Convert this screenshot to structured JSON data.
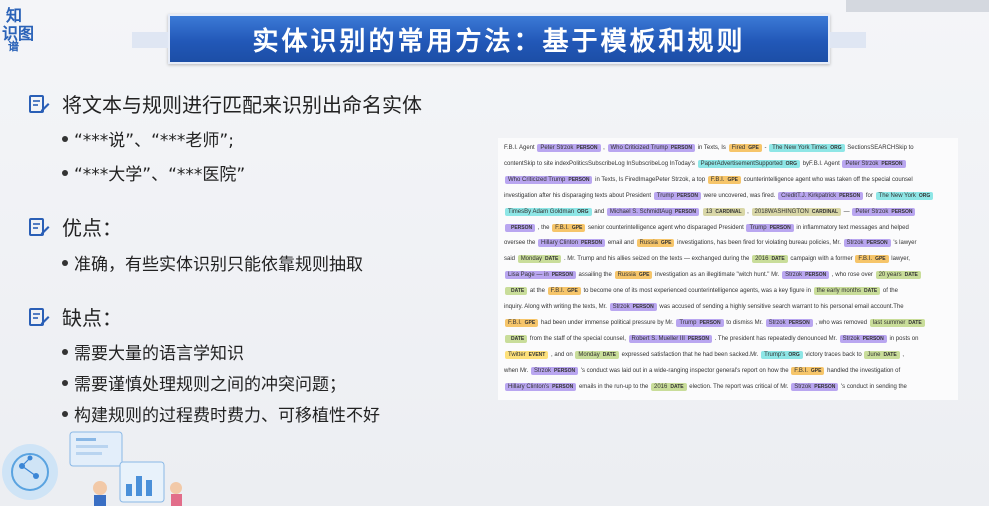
{
  "logo": {
    "line1": "知",
    "line2": "识图",
    "line3": "谱"
  },
  "top_right_brand": "",
  "title": "实体识别的常用方法：基于模板和规则",
  "sections": [
    {
      "title": "将文本与规则进行匹配来识别出命名实体",
      "bullets": [
        "“***说”、“***老师”;",
        "“***大学”、“***医院”"
      ]
    },
    {
      "title": "优点：",
      "bullets": [
        "准确，有些实体识别只能依靠规则抽取"
      ]
    },
    {
      "title": "缺点：",
      "bullets": [
        "需要大量的语言学知识",
        "需要谨慎处理规则之间的冲突问题；",
        "构建规则的过程费时费力、可移植性不好"
      ]
    }
  ],
  "ner_example": {
    "lines": [
      [
        [
          "t",
          "F.B.I. Agent "
        ],
        [
          "e",
          "Peter Strzok",
          "PERSON"
        ],
        [
          "t",
          " , "
        ],
        [
          "e",
          "Who Criticized Trump",
          "PERSON"
        ],
        [
          "t",
          " in Texts, Is "
        ],
        [
          "e",
          "Fired",
          "GPE"
        ],
        [
          "t",
          " - "
        ],
        [
          "e",
          "The New York Times",
          "ORG"
        ],
        [
          "t",
          " SectionsSEARCHSkip to"
        ]
      ],
      [
        [
          "t",
          "contentSkip to site indexPoliticsSubscribeLog InSubscribeLog InToday's "
        ],
        [
          "e",
          "PaperAdvertisementSupported",
          "ORG"
        ],
        [
          "t",
          " byF.B.I. Agent "
        ],
        [
          "e",
          "Peter Strzok",
          "PERSON"
        ]
      ],
      [
        [
          "e",
          "Who Criticized Trump",
          "PERSON"
        ],
        [
          "t",
          " in Texts, Is FiredImagePeter Strzok, a top "
        ],
        [
          "e",
          "F.B.I.",
          "GPE"
        ],
        [
          "t",
          " counterintelligence agent who was taken off the special counsel"
        ]
      ],
      [
        [
          "t",
          "investigation after his disparaging texts about President "
        ],
        [
          "e",
          "Trump",
          "PERSON"
        ],
        [
          "t",
          " were uncovered, was fired. "
        ],
        [
          "e",
          "CreditT.J. Kirkpatrick",
          "PERSON"
        ],
        [
          "t",
          " for "
        ],
        [
          "e",
          "The New York",
          "ORG"
        ]
      ],
      [
        [
          "e",
          "TimesBy Adam Goldman",
          "ORG"
        ],
        [
          "t",
          " and "
        ],
        [
          "e",
          "Michael S. SchmidtAug",
          "PERSON"
        ],
        [
          "t",
          " "
        ],
        [
          "e",
          "13",
          "CARDINAL"
        ],
        [
          "t",
          " , "
        ],
        [
          "e",
          "2018WASHINGTON",
          "CARDINAL"
        ],
        [
          "t",
          " — "
        ],
        [
          "e",
          "Peter Strzok",
          "PERSON"
        ]
      ],
      [
        [
          "e",
          "",
          "PERSON"
        ],
        [
          "t",
          " , the "
        ],
        [
          "e",
          "F.B.I.",
          "GPE"
        ],
        [
          "t",
          " senior counterintelligence agent who disparaged President "
        ],
        [
          "e",
          "Trump",
          "PERSON"
        ],
        [
          "t",
          " in inflammatory text messages and helped"
        ]
      ],
      [
        [
          "t",
          "oversee the "
        ],
        [
          "e",
          "Hillary Clinton",
          "PERSON"
        ],
        [
          "t",
          " email and "
        ],
        [
          "e",
          "Russia",
          "GPE"
        ],
        [
          "t",
          " investigations, has been fired for violating bureau policies, Mr. "
        ],
        [
          "e",
          "Strzok",
          "PERSON"
        ],
        [
          "t",
          " 's lawyer"
        ]
      ],
      [
        [
          "t",
          "said "
        ],
        [
          "e",
          "Monday",
          "DATE"
        ],
        [
          "t",
          " . Mr. Trump and his allies seized on the texts — exchanged during the "
        ],
        [
          "e",
          "2016",
          "DATE"
        ],
        [
          "t",
          " campaign with a former "
        ],
        [
          "e",
          "F.B.I.",
          "GPE"
        ],
        [
          "t",
          " lawyer,"
        ]
      ],
      [
        [
          "e",
          "Lisa Page — in",
          "PERSON"
        ],
        [
          "t",
          " assailing the "
        ],
        [
          "e",
          "Russia",
          "GPE"
        ],
        [
          "t",
          " investigation as an illegitimate \"witch hunt.\" Mr. "
        ],
        [
          "e",
          "Strzok",
          "PERSON"
        ],
        [
          "t",
          " , who rose over "
        ],
        [
          "e",
          "20 years",
          "DATE"
        ]
      ],
      [
        [
          "e",
          "",
          "DATE"
        ],
        [
          "t",
          " at the "
        ],
        [
          "e",
          "F.B.I.",
          "GPE"
        ],
        [
          "t",
          " to become one of its most experienced counterintelligence agents, was a key figure in "
        ],
        [
          "e",
          "the early months",
          "DATE"
        ],
        [
          "t",
          " of the"
        ]
      ],
      [
        [
          "t",
          "inquiry. Along with writing the texts, Mr. "
        ],
        [
          "e",
          "Strzok",
          "PERSON"
        ],
        [
          "t",
          " was accused of sending a highly sensitive search warrant to his personal email account.The"
        ]
      ],
      [
        [
          "e",
          "F.B.I.",
          "GPE"
        ],
        [
          "t",
          " had been under immense political pressure by Mr. "
        ],
        [
          "e",
          "Trump",
          "PERSON"
        ],
        [
          "t",
          " to dismiss Mr. "
        ],
        [
          "e",
          "Strzok",
          "PERSON"
        ],
        [
          "t",
          " , who was removed "
        ],
        [
          "e",
          "last summer",
          "DATE"
        ]
      ],
      [
        [
          "e",
          "",
          "DATE"
        ],
        [
          "t",
          " from the staff of the special counsel, "
        ],
        [
          "e",
          "Robert S. Mueller III",
          "PERSON"
        ],
        [
          "t",
          " . The president has repeatedly denounced Mr. "
        ],
        [
          "e",
          "Strzok",
          "PERSON"
        ],
        [
          "t",
          " in posts on"
        ]
      ],
      [
        [
          "e",
          "Twitter",
          "EVENT"
        ],
        [
          "t",
          " , and on "
        ],
        [
          "e",
          "Monday",
          "DATE"
        ],
        [
          "t",
          " expressed satisfaction that he had been sacked.Mr. "
        ],
        [
          "e",
          "Trump's",
          "ORG"
        ],
        [
          "t",
          " victory traces back to "
        ],
        [
          "e",
          "June",
          "DATE"
        ],
        [
          "t",
          " ,"
        ]
      ],
      [
        [
          "t",
          "when Mr. "
        ],
        [
          "e",
          "Strzok",
          "PERSON"
        ],
        [
          "t",
          " 's conduct was laid out in a wide-ranging inspector general's report on how the "
        ],
        [
          "e",
          "F.B.I.",
          "GPE"
        ],
        [
          "t",
          " handled the investigation of"
        ]
      ],
      [
        [
          "e",
          "Hillary Clinton's",
          "PERSON"
        ],
        [
          "t",
          " emails in the run-up to the "
        ],
        [
          "e",
          "2016",
          "DATE"
        ],
        [
          "t",
          " election. The report was critical of Mr. "
        ],
        [
          "e",
          "Strzok",
          "PERSON"
        ],
        [
          "t",
          " 's conduct in sending the"
        ]
      ]
    ]
  },
  "colors": {
    "title_bar": "#2258b8",
    "person": "#b9a6f0",
    "org": "#8ee6e6",
    "gpe": "#f6c56a",
    "date": "#c9dd9a",
    "cardinal": "#d9d7a8",
    "event": "#fde07a"
  }
}
